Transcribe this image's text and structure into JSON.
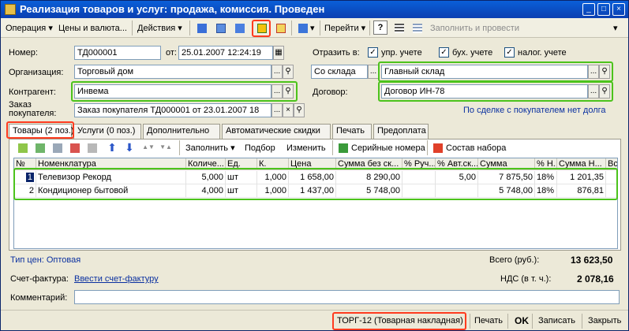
{
  "window": {
    "title": "Реализация товаров и услуг: продажа, комиссия. Проведен",
    "controls": [
      "_",
      "□",
      "×"
    ]
  },
  "toolbar": {
    "operation": "Операция",
    "prices": "Цены и валюта...",
    "actions": "Действия",
    "goto": "Перейти",
    "help": "?",
    "fill_and_post": "Заполнить и провести"
  },
  "header": {
    "number_label": "Номер:",
    "number_value": "ТД000001",
    "date_label": "от:",
    "date_value": "25.01.2007 12:24:19",
    "reflect_label": "Отразить в:",
    "cb_mgmt": "упр. учете",
    "cb_accounting": "бух. учете",
    "cb_tax": "налог. учете",
    "org_label": "Организация:",
    "org_value": "Торговый дом",
    "ship_from_value": "Со склада",
    "warehouse_value": "Главный склад",
    "counterparty_label": "Контрагент:",
    "counterparty_value": "Инвема",
    "contract_label": "Договор:",
    "contract_value": "Договор ИН-78",
    "order_label_1": "Заказ",
    "order_label_2": "покупателя:",
    "order_value": "Заказ покупателя ТД000001 от 23.01.2007 18",
    "deal_link": "По сделке с покупателем нет долга"
  },
  "tabs": [
    "Товары (2 поз.)",
    "Услуги (0 поз.)",
    "Дополнительно",
    "Автоматические скидки",
    "Печать",
    "Предоплата"
  ],
  "subtoolbar": {
    "fill": "Заполнить",
    "selection": "Подбор",
    "change": "Изменить",
    "serials": "Серийные номера",
    "kit": "Состав набора"
  },
  "grid": {
    "columns": [
      "№",
      "Номенклатура",
      "Количе...",
      "Ед.",
      "К.",
      "Цена",
      "Сумма без ск...",
      "% Руч...",
      "% Авт.ск...",
      "Сумма",
      "% Н...",
      "Сумма Н...",
      "Вс"
    ],
    "rows": [
      [
        "1",
        "Телевизор Рекорд",
        "5,000",
        "шт",
        "1,000",
        "1 658,00",
        "8 290,00",
        "",
        "5,00",
        "7 875,50",
        "18%",
        "1 201,35"
      ],
      [
        "2",
        "Кондиционер бытовой",
        "4,000",
        "шт",
        "1,000",
        "1 437,00",
        "5 748,00",
        "",
        "",
        "5 748,00",
        "18%",
        "876,81"
      ]
    ]
  },
  "footer": {
    "price_type": "Тип цен: Оптовая",
    "total_label": "Всего (руб.):",
    "total_value": "13 623,50",
    "invoice_label": "Счет-фактура:",
    "invoice_link": "Ввести счет-фактуру",
    "vat_label": "НДС (в т. ч.):",
    "vat_value": "2 078,16",
    "comment_label": "Комментарий:",
    "comment_value": ""
  },
  "bottom_buttons": {
    "torg12": "ТОРГ-12 (Товарная накладная)",
    "print": "Печать",
    "ok": "OK",
    "save": "Записать",
    "close": "Закрыть"
  }
}
